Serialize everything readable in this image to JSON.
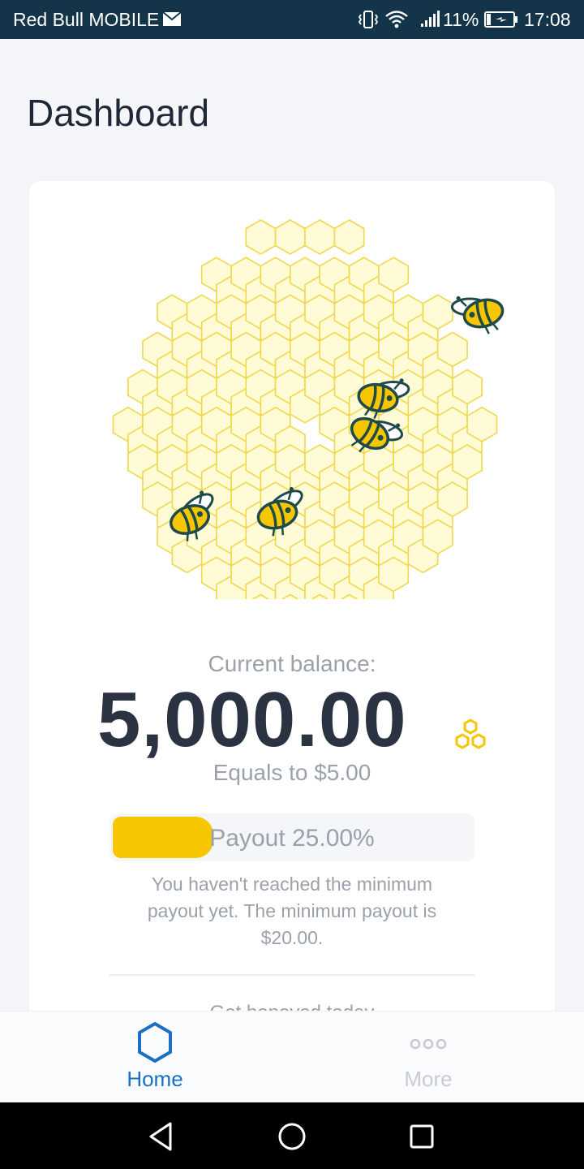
{
  "status_bar": {
    "carrier": "Red Bull MOBILE",
    "battery_percent": "11%",
    "time": "17:08",
    "icons": [
      "mail-icon",
      "vibrate-icon",
      "wifi-icon",
      "signal-icon",
      "battery-charging-icon"
    ]
  },
  "page": {
    "title": "Dashboard"
  },
  "balance": {
    "label": "Current balance:",
    "value": "5,000.00",
    "currency_icon": "honeycomb-icon",
    "equals": "Equals to $5.00"
  },
  "payout": {
    "label": "Payout 25.00%",
    "progress_fraction": 0.25,
    "note": "You haven't reached the minimum payout yet. The minimum payout is $20.00.",
    "next_section_heading": "Get honeyed today"
  },
  "bottom_nav": {
    "items": [
      {
        "label": "Home",
        "icon": "hexagon-icon",
        "active": true
      },
      {
        "label": "More",
        "icon": "more-dots-icon",
        "active": false
      }
    ]
  },
  "system_nav": {
    "icons": [
      "back-icon",
      "home-circle-icon",
      "recents-icon"
    ]
  },
  "colors": {
    "status_bar": "#14344a",
    "accent_blue": "#1a6fc4",
    "honey_yellow": "#f6c700",
    "cell_fill": "#fffbd6",
    "cell_stroke": "#f1d84a",
    "bee_outline": "#1e4a4a",
    "text_dark": "#2b3342",
    "text_muted": "#9aa1ab"
  }
}
